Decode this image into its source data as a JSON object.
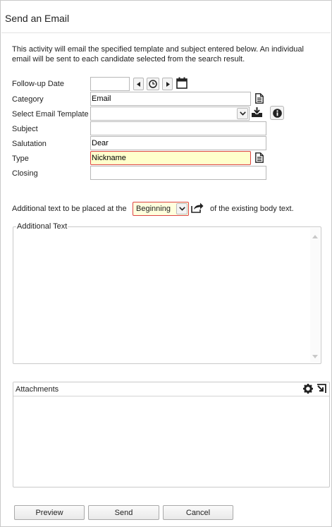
{
  "dialog": {
    "title": "Send an Email",
    "description": "This activity will email the specified template and subject entered below. An individual email will be sent to each candidate selected from the search result."
  },
  "form": {
    "followup_label": "Follow-up Date",
    "followup_value": "",
    "category_label": "Category",
    "category_value": "Email",
    "template_label": "Select Email Template",
    "template_value": "",
    "subject_label": "Subject",
    "subject_value": "",
    "salutation_label": "Salutation",
    "salutation_value": "Dear",
    "type_label": "Type",
    "type_value": "Nickname",
    "closing_label": "Closing",
    "closing_value": ""
  },
  "additional": {
    "prefix": "Additional text to be placed at the",
    "position_value": "Beginning",
    "suffix": "of the existing body text.",
    "legend": "Additional Text"
  },
  "attachments": {
    "title": "Attachments"
  },
  "buttons": {
    "preview": "Preview",
    "send": "Send",
    "cancel": "Cancel"
  },
  "icons": [
    "prev-icon",
    "clock-icon",
    "next-icon",
    "calendar-icon",
    "document-icon",
    "download-icon",
    "info-icon",
    "share-icon",
    "gear-icon",
    "expand-icon"
  ],
  "colors": {
    "highlight_bg": "#ffffcc",
    "highlight_border": "#dd4444"
  }
}
